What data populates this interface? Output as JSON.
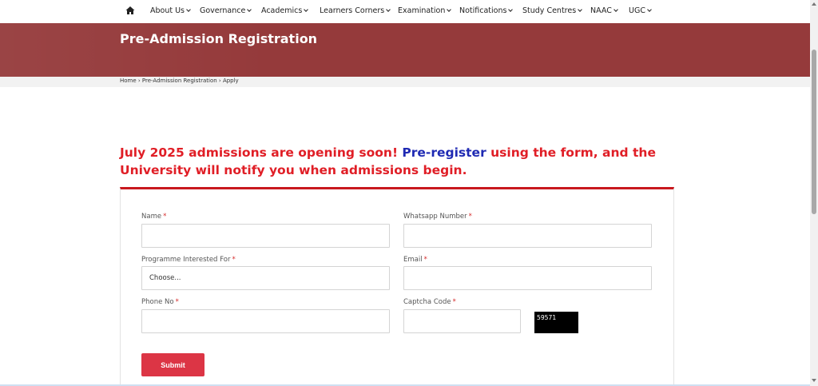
{
  "nav": {
    "home_icon": "home-icon",
    "items": [
      {
        "label": "About Us"
      },
      {
        "label": "Governance"
      },
      {
        "label": "Academics"
      },
      {
        "label": "Learners Corners"
      },
      {
        "label": "Examination"
      },
      {
        "label": "Notifications"
      },
      {
        "label": "Study Centres"
      },
      {
        "label": "NAAC"
      },
      {
        "label": "UGC"
      }
    ]
  },
  "banner": {
    "title": "Pre-Admission Registration",
    "color": "#953a3b"
  },
  "breadcrumb": {
    "text": "Home › Pre-Admission Registration › Apply"
  },
  "headline": {
    "part1": "July 2025 admissions are opening soon! ",
    "link": "Pre-register",
    "part2": " using the form, and the University will notify you when admissions begin.",
    "color": "#e01e26",
    "link_color": "#1f2ab3"
  },
  "form": {
    "required_mark": "*",
    "name_label": "Name",
    "whatsapp_label": "Whatsapp Number",
    "programme_label": "Programme Interested For",
    "programme_value": "Choose...",
    "email_label": "Email",
    "phone_label": "Phone No",
    "captcha_label": "Captcha Code",
    "captcha_code": "59571",
    "submit_label": "Submit",
    "submit_color": "#dc3545"
  }
}
